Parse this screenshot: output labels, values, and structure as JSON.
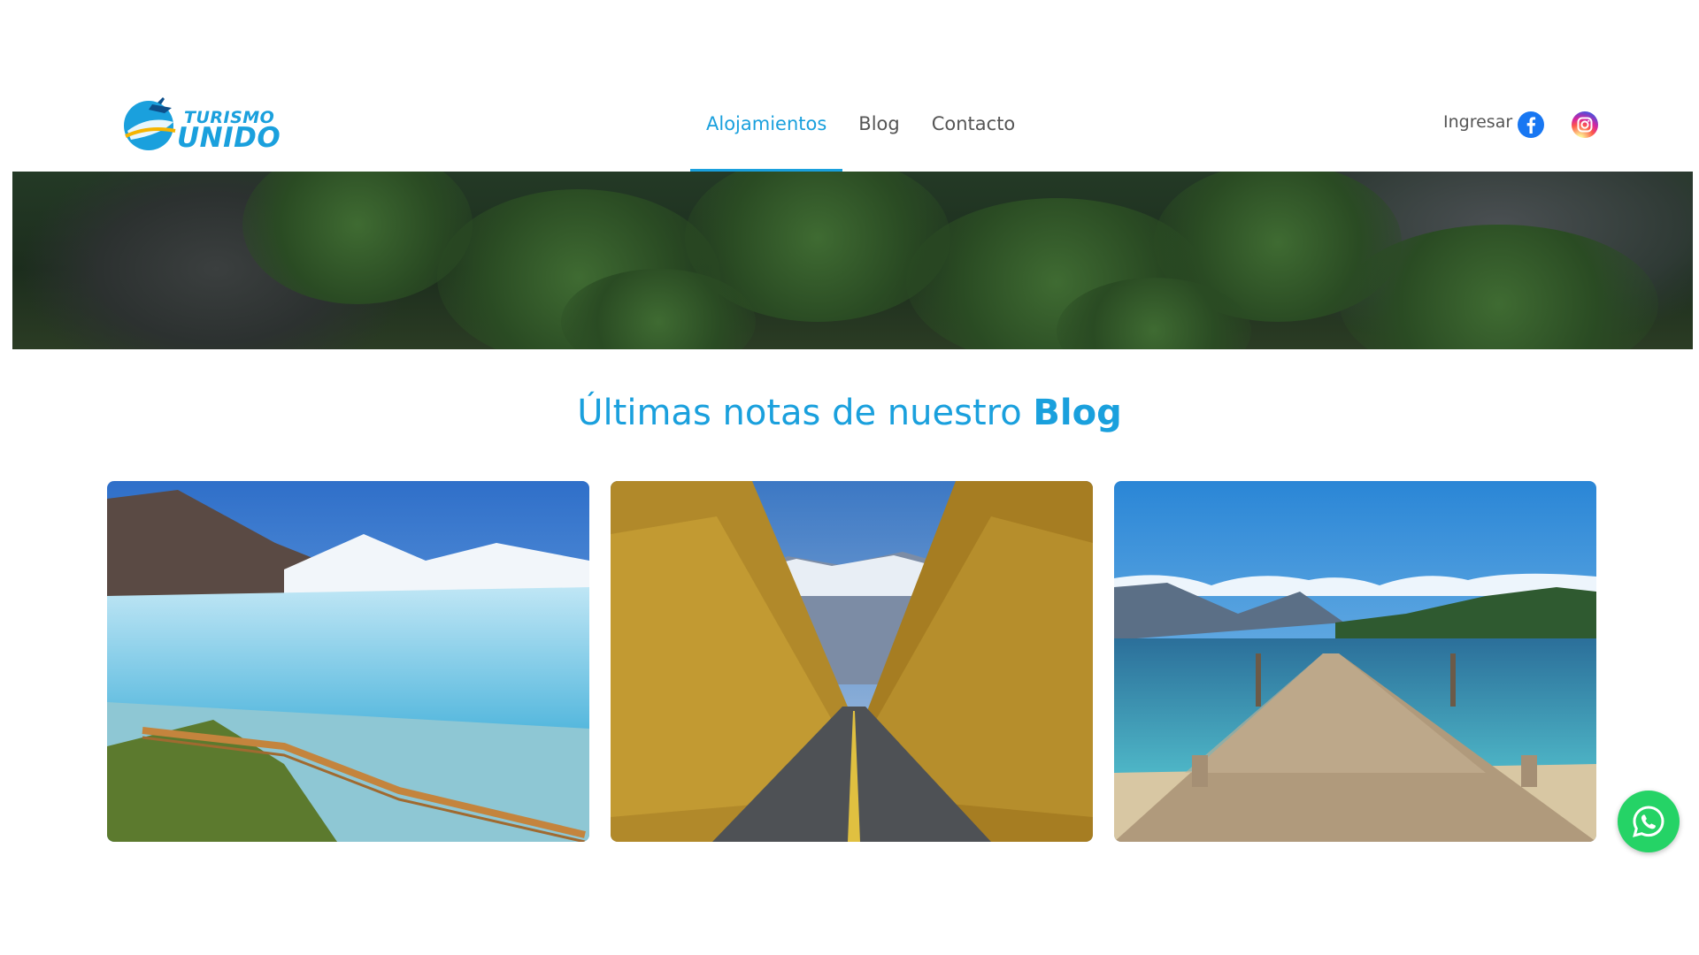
{
  "brand": {
    "line1": "TURISMO",
    "line2": "UNIDO",
    "color": "#1aa0dd"
  },
  "nav": {
    "items": [
      {
        "label": "Alojamientos",
        "active": true
      },
      {
        "label": "Blog",
        "active": false
      },
      {
        "label": "Contacto",
        "active": false
      }
    ]
  },
  "header_right": {
    "login_label": "Ingresar",
    "icons": [
      "facebook-icon",
      "instagram-icon"
    ]
  },
  "blog": {
    "title_prefix": "Últimas notas de nuestro",
    "title_emphasis": "Blog",
    "cards": [
      {
        "image": "glacier-walkway-image"
      },
      {
        "image": "autumn-tree-road-image"
      },
      {
        "image": "lake-pier-image"
      }
    ]
  },
  "floating": {
    "icon": "whatsapp-icon",
    "color": "#25d366"
  }
}
